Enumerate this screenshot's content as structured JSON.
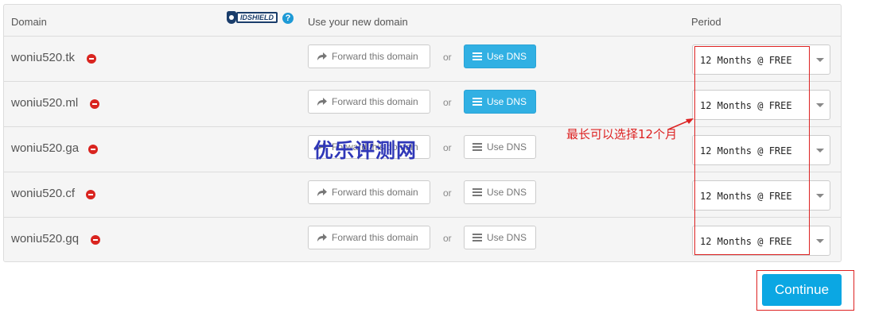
{
  "table": {
    "headers": {
      "domain": "Domain",
      "use_domain": "Use your new domain",
      "period": "Period"
    },
    "idshield_label": "IDSHIELD",
    "help_icon_glyph": "?",
    "rows": [
      {
        "domain": "woniu520.tk",
        "forward_label": "Forward this domain",
        "or_label": "or",
        "dns_label": "Use DNS",
        "dns_active": true,
        "period": "12 Months @ FREE"
      },
      {
        "domain": "woniu520.ml",
        "forward_label": "Forward this domain",
        "or_label": "or",
        "dns_label": "Use DNS",
        "dns_active": true,
        "period": "12 Months @ FREE"
      },
      {
        "domain": "woniu520.ga",
        "forward_label": "Forward this domain",
        "or_label": "or",
        "dns_label": "Use DNS",
        "dns_active": false,
        "period": "12 Months @ FREE"
      },
      {
        "domain": "woniu520.cf",
        "forward_label": "Forward this domain",
        "or_label": "or",
        "dns_label": "Use DNS",
        "dns_active": false,
        "period": "12 Months @ FREE"
      },
      {
        "domain": "woniu520.gq",
        "forward_label": "Forward this domain",
        "or_label": "or",
        "dns_label": "Use DNS",
        "dns_active": false,
        "period": "12 Months @ FREE"
      }
    ]
  },
  "annotation": "最长可以选择12个月",
  "watermark": "优乐评测网",
  "continue_label": "Continue",
  "colors": {
    "accent": "#31b0e3",
    "continue": "#0ba7e3",
    "annotation": "#dd2222",
    "remove": "#d9241f"
  }
}
